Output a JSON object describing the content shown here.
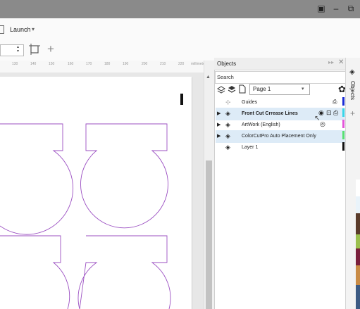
{
  "title_bar": {
    "buttons": [
      "▣",
      "‒",
      "⧉"
    ]
  },
  "menubar": {
    "launch_label": "Launch"
  },
  "ruler": {
    "ticks": [
      "130",
      "140",
      "150",
      "160",
      "170",
      "180",
      "190",
      "200",
      "210",
      "220",
      "230"
    ],
    "unit": "millimeters"
  },
  "objects": {
    "title": "Objects",
    "search_placeholder": "Search",
    "page_selector": "Page 1",
    "side_tab_label": "Objects",
    "layers": [
      {
        "name": "Guides",
        "bold": false,
        "selected": false,
        "expand": false
      },
      {
        "name": "Front Cut  Crrease Lines",
        "bold": true,
        "selected": true,
        "expand": true
      },
      {
        "name": "ArtWork (English)",
        "bold": false,
        "selected": false,
        "expand": true
      },
      {
        "name": "ColorCutPro Auto Placement Only",
        "bold": false,
        "selected": true,
        "expand": true
      },
      {
        "name": "Layer 1",
        "bold": false,
        "selected": false,
        "expand": false
      }
    ],
    "layer_colors": [
      "#1a2bd6",
      "#3ad6e8",
      "#e356d9",
      "#59e072",
      "#111111"
    ]
  },
  "accent_colors": {
    "cut_path": "#9b4fc2",
    "selection": "#ddebf7"
  }
}
